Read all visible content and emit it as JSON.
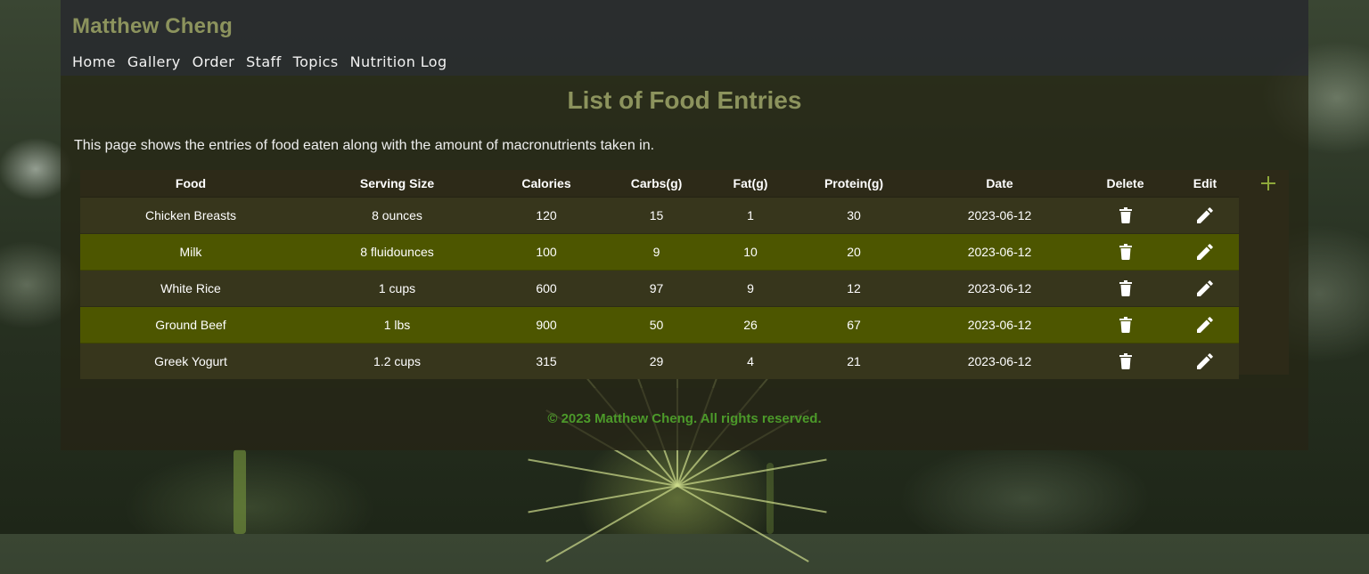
{
  "header": {
    "site_title": "Matthew Cheng",
    "nav": [
      "Home",
      "Gallery",
      "Order",
      "Staff",
      "Topics",
      "Nutrition Log"
    ]
  },
  "main": {
    "title": "List of Food Entries",
    "intro": "This page shows the entries of food eaten along with the amount of macronutrients taken in.",
    "table": {
      "headers": [
        "Food",
        "Serving Size",
        "Calories",
        "Carbs(g)",
        "Fat(g)",
        "Protein(g)",
        "Date",
        "Delete",
        "Edit"
      ],
      "rows": [
        {
          "food": "Chicken Breasts",
          "serving": "8 ounces",
          "calories": "120",
          "carbs": "15",
          "fat": "1",
          "protein": "30",
          "date": "2023-06-12"
        },
        {
          "food": "Milk",
          "serving": "8 fluidounces",
          "calories": "100",
          "carbs": "9",
          "fat": "10",
          "protein": "20",
          "date": "2023-06-12"
        },
        {
          "food": "White Rice",
          "serving": "1 cups",
          "calories": "600",
          "carbs": "97",
          "fat": "9",
          "protein": "12",
          "date": "2023-06-12"
        },
        {
          "food": "Ground Beef",
          "serving": "1 lbs",
          "calories": "900",
          "carbs": "50",
          "fat": "26",
          "protein": "67",
          "date": "2023-06-12"
        },
        {
          "food": "Greek Yogurt",
          "serving": "1.2 cups",
          "calories": "315",
          "carbs": "29",
          "fat": "4",
          "protein": "21",
          "date": "2023-06-12"
        }
      ]
    },
    "icons": {
      "delete": "trash-icon",
      "edit": "pencil-icon",
      "add": "plus-icon"
    }
  },
  "footer": {
    "copyright": "© 2023 Matthew Cheng. All rights reserved."
  },
  "colors": {
    "title": "#8c935d",
    "row_odd": "#37361c",
    "row_even": "#4d5600",
    "footer_text": "#4c9a2a",
    "add_icon": "#8ea83a"
  }
}
